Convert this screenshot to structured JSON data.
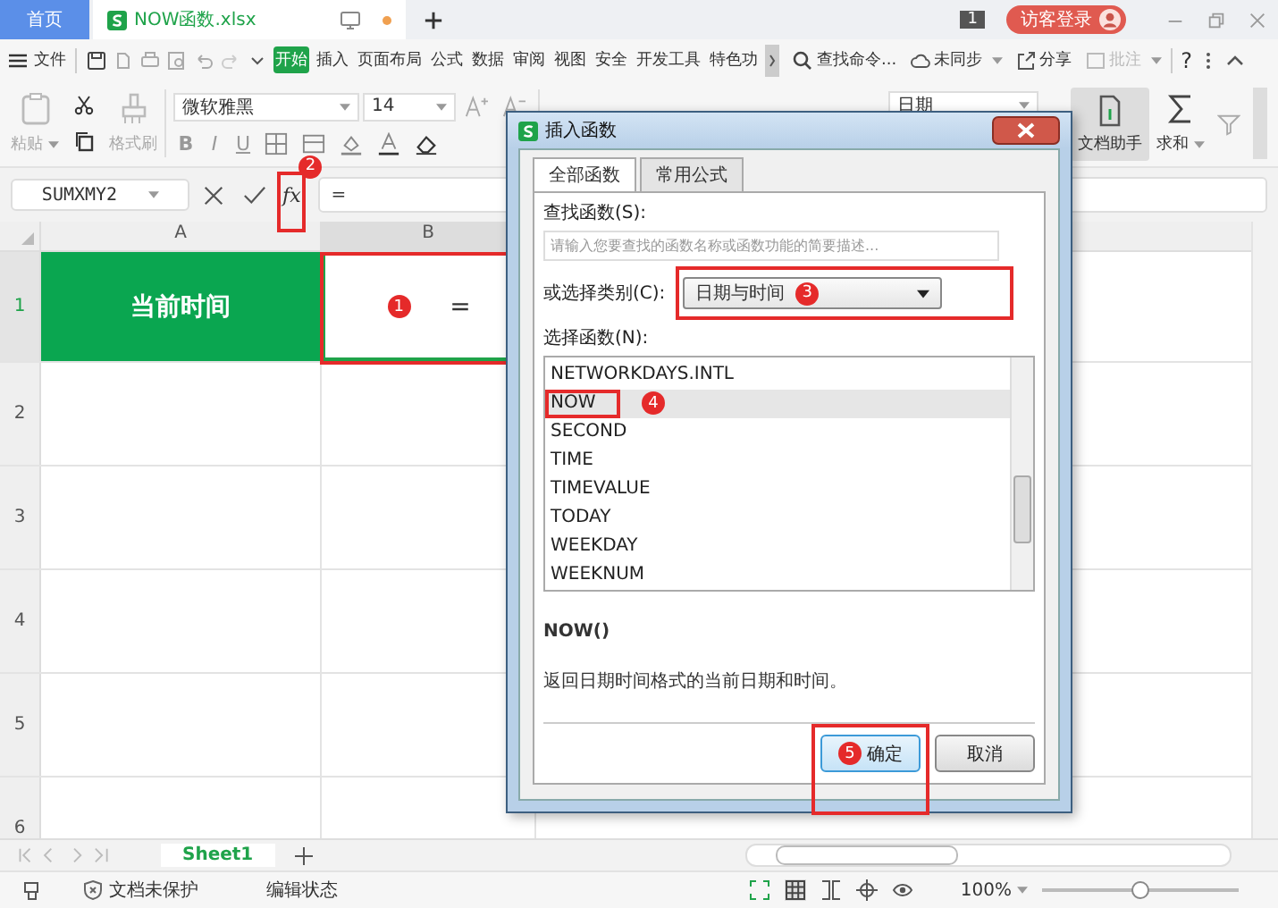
{
  "tabs": [
    {
      "label": "首页",
      "kind": "home",
      "selected": false
    },
    {
      "label": "NOW函数.xlsx",
      "kind": "file",
      "selected": true
    }
  ],
  "title_bar": {
    "page_count": "1",
    "login": "访客登录"
  },
  "menu": {
    "file": "文件",
    "tabs": [
      {
        "label": "开始",
        "selected": true
      },
      {
        "label": "插入",
        "selected": false
      },
      {
        "label": "页面布局",
        "selected": false
      },
      {
        "label": "公式",
        "selected": false
      },
      {
        "label": "数据",
        "selected": false
      },
      {
        "label": "审阅",
        "selected": false
      },
      {
        "label": "视图",
        "selected": false
      },
      {
        "label": "安全",
        "selected": false
      },
      {
        "label": "开发工具",
        "selected": false
      },
      {
        "label": "特色功",
        "selected": false
      }
    ],
    "search": "查找命令...",
    "sync": "未同步",
    "share": "分享",
    "comment": "批注",
    "help": "?"
  },
  "ribbon": {
    "paste": "粘贴",
    "format_painter": "格式刷",
    "font": "微软雅黑",
    "font_size": "14",
    "styles": [
      "B",
      "I",
      "U"
    ],
    "number_format": "日期",
    "assistant": "文档助手",
    "sum": "求和"
  },
  "formula_bar": {
    "name_box": "SUMXMY2",
    "fx": "fx",
    "value": "="
  },
  "sheet": {
    "columns": [
      "A",
      "B"
    ],
    "rows": [
      {
        "number": "1",
        "cells": [
          "当前时间",
          "="
        ]
      },
      {
        "number": "2",
        "cells": []
      },
      {
        "number": "3",
        "cells": []
      },
      {
        "number": "4",
        "cells": []
      },
      {
        "number": "5",
        "cells": []
      },
      {
        "number": "6",
        "cells": []
      }
    ]
  },
  "sheet_tabs": [
    {
      "label": "Sheet1",
      "selected": true
    }
  ],
  "status_bar": {
    "protection": "文档未保护",
    "mode": "编辑状态",
    "zoom": "100%",
    "zoom_slider": {
      "level": 0.5
    }
  },
  "dialog": {
    "title": "插入函数",
    "tabs": [
      {
        "label": "全部函数",
        "selected": true
      },
      {
        "label": "常用公式",
        "selected": false
      }
    ],
    "search_label": "查找函数(S):",
    "search_placeholder": "请输入您要查找的函数名称或函数功能的简要描述...",
    "category_label": "或选择类别(C):",
    "category": "日期与时间",
    "list_label": "选择函数(N):",
    "functions": [
      {
        "name": "NETWORKDAYS.INTL",
        "selected": false
      },
      {
        "name": "NOW",
        "selected": true
      },
      {
        "name": "SECOND",
        "selected": false
      },
      {
        "name": "TIME",
        "selected": false
      },
      {
        "name": "TIMEVALUE",
        "selected": false
      },
      {
        "name": "TODAY",
        "selected": false
      },
      {
        "name": "WEEKDAY",
        "selected": false
      },
      {
        "name": "WEEKNUM",
        "selected": false
      }
    ],
    "signature": "NOW()",
    "description": "返回日期时间格式的当前日期和时间。",
    "buttons": [
      {
        "label": "确定",
        "kind": "primary"
      },
      {
        "label": "取消",
        "kind": "secondary"
      }
    ]
  },
  "annotations": [
    {
      "number": "1"
    },
    {
      "number": "2"
    },
    {
      "number": "3"
    },
    {
      "number": "4"
    },
    {
      "number": "5"
    }
  ]
}
